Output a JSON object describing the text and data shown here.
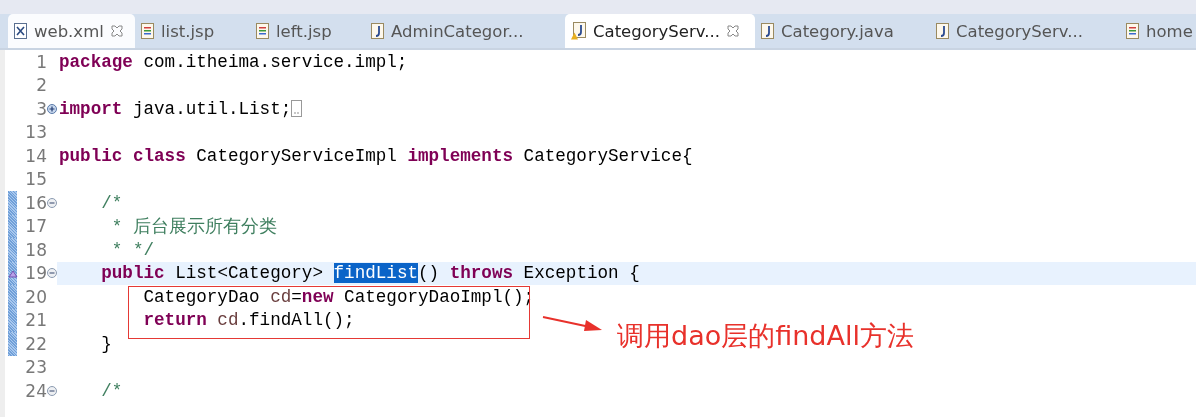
{
  "tabs": [
    {
      "label": "web.xml",
      "kind": "xml",
      "selected": false,
      "hovered": true,
      "closable": true
    },
    {
      "label": "list.jsp",
      "kind": "jsp",
      "selected": false,
      "hovered": false,
      "closable": false
    },
    {
      "label": "left.jsp",
      "kind": "jsp",
      "selected": false,
      "hovered": false,
      "closable": false
    },
    {
      "label": "AdminCategor...",
      "kind": "java",
      "selected": false,
      "hovered": false,
      "closable": false
    },
    {
      "label": "CategoryServ...",
      "kind": "java-warning",
      "selected": true,
      "hovered": false,
      "closable": true
    },
    {
      "label": "Category.java",
      "kind": "java",
      "selected": false,
      "hovered": false,
      "closable": false
    },
    {
      "label": "CategoryServ...",
      "kind": "java",
      "selected": false,
      "hovered": false,
      "closable": false
    },
    {
      "label": "home",
      "kind": "jsp",
      "selected": false,
      "hovered": false,
      "closable": false
    }
  ],
  "editor": {
    "lines": [
      {
        "number": "1",
        "collapsible": false,
        "expandable": false,
        "changed": false,
        "current": false,
        "override": false,
        "collapsed": false,
        "tokens": [
          {
            "kind": "keyword",
            "text": "package"
          },
          {
            "kind": "plain",
            "text": " com.itheima.service.impl;"
          }
        ]
      },
      {
        "number": "2",
        "collapsible": false,
        "expandable": false,
        "changed": false,
        "current": false,
        "override": false,
        "collapsed": false
      },
      {
        "number": "3",
        "collapsible": false,
        "expandable": true,
        "changed": false,
        "current": false,
        "override": false,
        "collapsed": true,
        "tokens": [
          {
            "kind": "keyword",
            "text": "import"
          },
          {
            "kind": "plain",
            "text": " java.util.List;"
          }
        ]
      },
      {
        "number": "13",
        "collapsible": false,
        "expandable": false,
        "changed": false,
        "current": false,
        "override": false,
        "collapsed": false
      },
      {
        "number": "14",
        "collapsible": false,
        "expandable": false,
        "changed": false,
        "current": false,
        "override": false,
        "collapsed": false,
        "tokens": [
          {
            "kind": "keyword",
            "text": "public class"
          },
          {
            "kind": "plain",
            "text": " CategoryServiceImpl "
          },
          {
            "kind": "keyword",
            "text": "implements"
          },
          {
            "kind": "plain",
            "text": " CategoryService{"
          }
        ]
      },
      {
        "number": "15",
        "collapsible": false,
        "expandable": false,
        "changed": false,
        "current": false,
        "override": false,
        "collapsed": false
      },
      {
        "number": "16",
        "collapsible": true,
        "expandable": false,
        "changed": true,
        "current": false,
        "override": false,
        "collapsed": false,
        "tokens": [
          {
            "kind": "comment",
            "text": "    /*"
          }
        ]
      },
      {
        "number": "17",
        "collapsible": false,
        "expandable": false,
        "changed": true,
        "current": false,
        "override": false,
        "collapsed": false,
        "tokens": [
          {
            "kind": "comment",
            "text": "     * 后台展示所有分类"
          }
        ]
      },
      {
        "number": "18",
        "collapsible": false,
        "expandable": false,
        "changed": true,
        "current": false,
        "override": false,
        "collapsed": false,
        "tokens": [
          {
            "kind": "comment",
            "text": "     * */"
          }
        ]
      },
      {
        "number": "19",
        "collapsible": true,
        "expandable": false,
        "changed": true,
        "current": true,
        "override": true,
        "collapsed": false,
        "tokens": [
          {
            "kind": "keyword",
            "text": "    public"
          },
          {
            "kind": "plain",
            "text": " List<Category> "
          },
          {
            "kind": "selected",
            "text": "findList"
          },
          {
            "kind": "plain",
            "text": "() "
          },
          {
            "kind": "keyword",
            "text": "throws"
          },
          {
            "kind": "plain",
            "text": " Exception {"
          }
        ]
      },
      {
        "number": "20",
        "collapsible": false,
        "expandable": false,
        "changed": true,
        "current": false,
        "override": false,
        "collapsed": false,
        "tokens": [
          {
            "kind": "plain",
            "text": "        CategoryDao "
          },
          {
            "kind": "variable",
            "text": "cd"
          },
          {
            "kind": "plain",
            "text": "="
          },
          {
            "kind": "keyword",
            "text": "new"
          },
          {
            "kind": "plain",
            "text": " CategoryDaoImpl();"
          }
        ]
      },
      {
        "number": "21",
        "collapsible": false,
        "expandable": false,
        "changed": true,
        "current": false,
        "override": false,
        "collapsed": false,
        "tokens": [
          {
            "kind": "keyword",
            "text": "        return"
          },
          {
            "kind": "variable",
            "text": " cd"
          },
          {
            "kind": "plain",
            "text": ".findAll();"
          }
        ]
      },
      {
        "number": "22",
        "collapsible": false,
        "expandable": false,
        "changed": true,
        "current": false,
        "override": false,
        "collapsed": false,
        "tokens": [
          {
            "kind": "plain",
            "text": "    }"
          }
        ]
      },
      {
        "number": "23",
        "collapsible": false,
        "expandable": false,
        "changed": false,
        "current": false,
        "override": false,
        "collapsed": false
      },
      {
        "number": "24",
        "collapsible": true,
        "expandable": false,
        "changed": false,
        "current": false,
        "override": false,
        "collapsed": false,
        "tokens": [
          {
            "kind": "comment",
            "text": "    /*"
          }
        ]
      }
    ]
  },
  "annotation": {
    "text": "调用dao层的findAll方法"
  }
}
